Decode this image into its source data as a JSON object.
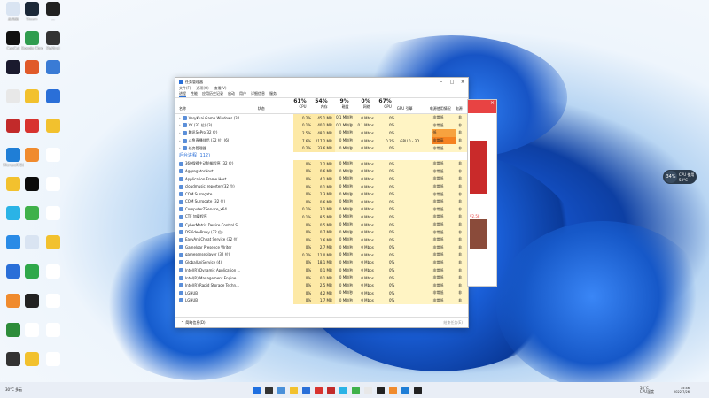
{
  "desktop": {
    "icons": [
      {
        "label": "此电脑",
        "color": "#d9e4f2"
      },
      {
        "label": "Steam",
        "color": "#1b2838"
      },
      {
        "label": "...",
        "color": "#222222"
      },
      {
        "label": "CapCut",
        "color": "#111111"
      },
      {
        "label": "Google Chrome",
        "color": "#2f9c4f"
      },
      {
        "label": "DaVinci",
        "color": "#333333"
      },
      {
        "label": "",
        "color": "#1a1a2e"
      },
      {
        "label": "",
        "color": "#e05a2a"
      },
      {
        "label": "",
        "color": "#3a7bd5"
      },
      {
        "label": "",
        "color": "#e8e8e8"
      },
      {
        "label": "",
        "color": "#f2c12e"
      },
      {
        "label": "",
        "color": "#2a6fd8"
      },
      {
        "label": "",
        "color": "#c22a2a"
      },
      {
        "label": "",
        "color": "#d8332f"
      },
      {
        "label": "",
        "color": "#f2c12e"
      },
      {
        "label": "Microsoft Edge",
        "color": "#1f7ed6"
      },
      {
        "label": "",
        "color": "#f08b2e"
      },
      {
        "label": "",
        "color": "#ffffff"
      },
      {
        "label": "",
        "color": "#f2c12e"
      },
      {
        "label": "",
        "color": "#0b0b0b"
      },
      {
        "label": "",
        "color": "#ffffff"
      },
      {
        "label": "",
        "color": "#2ab3e6"
      },
      {
        "label": "",
        "color": "#3fb14a"
      },
      {
        "label": "",
        "color": "#ffffff"
      },
      {
        "label": "",
        "color": "#2a8be6"
      },
      {
        "label": "",
        "color": "#d9e4f2"
      },
      {
        "label": "",
        "color": "#f2c12e"
      },
      {
        "label": "",
        "color": "#2a6fd8"
      },
      {
        "label": "",
        "color": "#2fa84a"
      },
      {
        "label": "",
        "color": "#ffffff"
      },
      {
        "label": "",
        "color": "#f08b2e"
      },
      {
        "label": "",
        "color": "#222222"
      },
      {
        "label": "",
        "color": "#ffffff"
      },
      {
        "label": "",
        "color": "#2d8c3a"
      },
      {
        "label": "",
        "color": "#ffffff"
      },
      {
        "label": "",
        "color": "#ffffff"
      },
      {
        "label": "",
        "color": "#333333"
      },
      {
        "label": "",
        "color": "#f2c12e"
      },
      {
        "label": "",
        "color": "#ffffff"
      }
    ]
  },
  "taskmgr": {
    "title": "任务管理器",
    "menu": [
      "文件(F)",
      "选项(O)",
      "查看(V)"
    ],
    "tabs": [
      "进程",
      "性能",
      "应用历史记录",
      "启动",
      "用户",
      "详细信息",
      "服务"
    ],
    "headers": {
      "name": "名称",
      "status": "状态",
      "cpu_pct": "61%",
      "cpu": "CPU",
      "mem_pct": "54%",
      "mem": "内存",
      "disk_pct": "9%",
      "disk": "磁盘",
      "net_pct": "0%",
      "net": "网络",
      "gpu_pct": "67%",
      "gpu": "GPU",
      "gpu_engine": "GPU 引擎",
      "power": "电源使用情况",
      "trend": "电源"
    },
    "apps": [
      {
        "name": "VeryKuai Game Windows (32...",
        "cpu": "0.2%",
        "mem": "45.1 MB",
        "disk": "0.1 MB/秒",
        "net": "0 Mbps",
        "gpu": "0%",
        "engine": "",
        "power": "非常低",
        "trend": "非",
        "pwclass": ""
      },
      {
        "name": "YY (32 位) (3)",
        "cpu": "0.1%",
        "mem": "40.1 MB",
        "disk": "0.1 MB/秒",
        "net": "0.1 Mbps",
        "gpu": "0%",
        "engine": "",
        "power": "非常低",
        "trend": "非",
        "pwclass": ""
      },
      {
        "name": "腾讯SoPro(32 位)",
        "cpu": "2.5%",
        "mem": "48.1 MB",
        "disk": "0 MB/秒",
        "net": "0 Mbps",
        "gpu": "0%",
        "engine": "",
        "power": "低",
        "trend": "非",
        "pwclass": "hi2"
      },
      {
        "name": "斗鱼直播伴侣 (32 位) (6)",
        "cpu": "7.6%",
        "mem": "217.2 MB",
        "disk": "0 MB/秒",
        "net": "0 Mbps",
        "gpu": "0.2%",
        "engine": "GPU 0 - 3D",
        "power": "非常高",
        "trend": "非",
        "pwclass": "hi"
      },
      {
        "name": "任务管理器",
        "cpu": "0.2%",
        "mem": "33.6 MB",
        "disk": "0 MB/秒",
        "net": "0 Mbps",
        "gpu": "0%",
        "engine": "",
        "power": "非常低",
        "trend": "非",
        "pwclass": ""
      }
    ],
    "background_label": "后台进程 (112)",
    "bg": [
      {
        "name": "360保镖主动防御程序 (32 位)",
        "cpu": "0%",
        "mem": "2.2 MB",
        "disk": "0 MB/秒",
        "net": "0 Mbps",
        "gpu": "0%",
        "power": "非常低",
        "trend": "非"
      },
      {
        "name": "AggregatorHost",
        "cpu": "0%",
        "mem": "0.6 MB",
        "disk": "0 MB/秒",
        "net": "0 Mbps",
        "gpu": "0%",
        "power": "非常低",
        "trend": "非"
      },
      {
        "name": "Application Frame Host",
        "cpu": "0%",
        "mem": "4.1 MB",
        "disk": "0 MB/秒",
        "net": "0 Mbps",
        "gpu": "0%",
        "power": "非常低",
        "trend": "非"
      },
      {
        "name": "cloudmusic_reporter (32 位)",
        "cpu": "0%",
        "mem": "0.1 MB",
        "disk": "0 MB/秒",
        "net": "0 Mbps",
        "gpu": "0%",
        "power": "非常低",
        "trend": "非"
      },
      {
        "name": "COM Surrogate",
        "cpu": "0%",
        "mem": "2.3 MB",
        "disk": "0 MB/秒",
        "net": "0 Mbps",
        "gpu": "0%",
        "power": "非常低",
        "trend": "非"
      },
      {
        "name": "COM Surrogate (32 位)",
        "cpu": "0%",
        "mem": "0.6 MB",
        "disk": "0 MB/秒",
        "net": "0 Mbps",
        "gpu": "0%",
        "power": "非常低",
        "trend": "非"
      },
      {
        "name": "ComputerZService_x64",
        "cpu": "0.1%",
        "mem": "3.1 MB",
        "disk": "0 MB/秒",
        "net": "0 Mbps",
        "gpu": "0%",
        "power": "非常低",
        "trend": "非"
      },
      {
        "name": "CTF 加载程序",
        "cpu": "0.1%",
        "mem": "8.5 MB",
        "disk": "0 MB/秒",
        "net": "0 Mbps",
        "gpu": "0%",
        "power": "非常低",
        "trend": "非"
      },
      {
        "name": "CyberMatrix Device Control S...",
        "cpu": "0%",
        "mem": "0.5 MB",
        "disk": "0 MB/秒",
        "net": "0 Mbps",
        "gpu": "0%",
        "power": "非常低",
        "trend": "非"
      },
      {
        "name": "DSVideoProxy (32 位)",
        "cpu": "0%",
        "mem": "0.7 MB",
        "disk": "0 MB/秒",
        "net": "0 Mbps",
        "gpu": "0%",
        "power": "非常低",
        "trend": "非"
      },
      {
        "name": "EasyAntiCheat Service (32 位)",
        "cpu": "0%",
        "mem": "1.6 MB",
        "disk": "0 MB/秒",
        "net": "0 Mbps",
        "gpu": "0%",
        "power": "非常低",
        "trend": "非"
      },
      {
        "name": "Gameloar Presence Writer",
        "cpu": "0%",
        "mem": "2.7 MB",
        "disk": "0 MB/秒",
        "net": "0 Mbps",
        "gpu": "0%",
        "power": "非常低",
        "trend": "非"
      },
      {
        "name": "gamesenseplayer (32 位)",
        "cpu": "0.2%",
        "mem": "12.0 MB",
        "disk": "0 MB/秒",
        "net": "0 Mbps",
        "gpu": "0%",
        "power": "非常低",
        "trend": "非"
      },
      {
        "name": "GlobalUniService (4)",
        "cpu": "0%",
        "mem": "18.1 MB",
        "disk": "0 MB/秒",
        "net": "0 Mbps",
        "gpu": "0%",
        "power": "非常低",
        "trend": "非"
      },
      {
        "name": "Intel(R) Dynamic Application ...",
        "cpu": "0%",
        "mem": "0.1 MB",
        "disk": "0 MB/秒",
        "net": "0 Mbps",
        "gpu": "0%",
        "power": "非常低",
        "trend": "非"
      },
      {
        "name": "Intel(R) Management Engine ...",
        "cpu": "0%",
        "mem": "0.1 MB",
        "disk": "0 MB/秒",
        "net": "0 Mbps",
        "gpu": "0%",
        "power": "非常低",
        "trend": "非"
      },
      {
        "name": "Intel(R) Rapid Storage Techn...",
        "cpu": "0%",
        "mem": "2.5 MB",
        "disk": "0 MB/秒",
        "net": "0 Mbps",
        "gpu": "0%",
        "power": "非常低",
        "trend": "非"
      },
      {
        "name": "LGHUB",
        "cpu": "0%",
        "mem": "4.2 MB",
        "disk": "0 MB/秒",
        "net": "0 Mbps",
        "gpu": "0%",
        "power": "非常低",
        "trend": "非"
      },
      {
        "name": "LGHUB",
        "cpu": "0%",
        "mem": "1.7 MB",
        "disk": "0 MB/秒",
        "net": "0 Mbps",
        "gpu": "0%",
        "power": "非常低",
        "trend": "非"
      }
    ],
    "status_less": "简略信息(D)",
    "status_end": "结束任务(E)"
  },
  "side_window": {
    "price": "¥2.58",
    "accent": "#e84343"
  },
  "widget": {
    "value": "34%",
    "line1": "CPU 使用",
    "line2": "53°C"
  },
  "taskbar": {
    "weather_temp": "30°C",
    "weather_text": "多云",
    "clock_time": "15:46",
    "clock_date": "2022/7/26",
    "tray_1": "58°C",
    "tray_2": "CPU温度",
    "icon_colors": [
      "#1f6fe0",
      "#333333",
      "#4a90d9",
      "#f2c12e",
      "#2a6fd8",
      "#d8332f",
      "#c22a2a",
      "#2ab3e6",
      "#3fb14a",
      "#e8e8e8",
      "#222222",
      "#f08b2e",
      "#1f7ed6",
      "#222222"
    ]
  }
}
